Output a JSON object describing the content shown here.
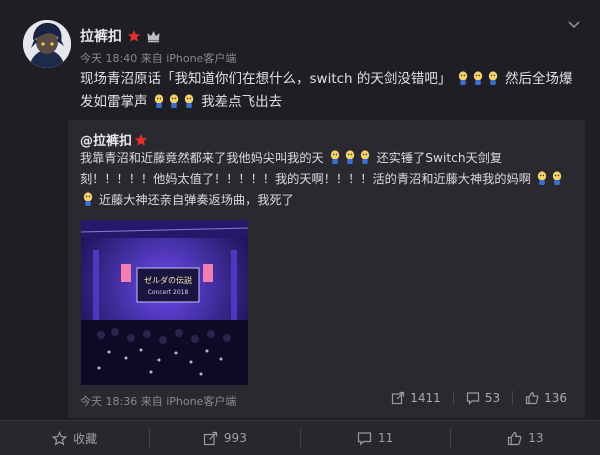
{
  "post": {
    "username": "拉裤扣",
    "meta": "今天 18:40 来自 iPhone客户端",
    "text_parts": [
      "现场青沼原话「我知道你们在想什么，switch 的天剑没错吧」",
      "然后全场爆发如雷掌声",
      "我差点飞出去"
    ]
  },
  "repost": {
    "author": "@拉裤扣",
    "text_parts": [
      "我靠青沼和近藤竟然都来了我他妈尖叫我的天",
      "还实锤了Switch天剑复刻！！！！！他妈太值了！！！！！我的天啊！！！！活的青沼和近藤大神我的妈啊",
      "近藤大神还亲自弹奏返场曲，我死了"
    ],
    "photo_screen_text": [
      "ゼルダの伝説",
      "Concert 2018"
    ],
    "meta": "今天 18:36 来自 iPhone客户端",
    "stats": {
      "reposts": "1411",
      "comments": "53",
      "likes": "136"
    }
  },
  "actions": {
    "favorite": "收藏",
    "repost": "993",
    "comment": "11",
    "like": "13"
  },
  "colors": {
    "background": "#1f1e24",
    "repost_background": "#2a2930",
    "accent_red": "#e5322d",
    "stage_purple": "#3a2a9c"
  }
}
